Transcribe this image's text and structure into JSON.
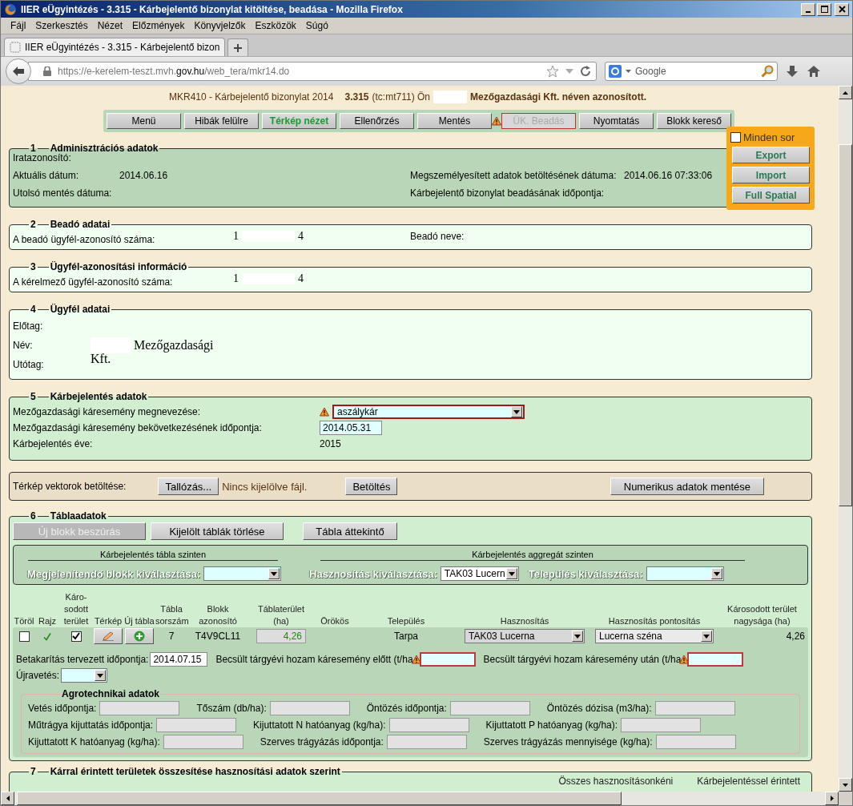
{
  "window": {
    "title": "IIER eÜgyintézés - 3.315 - Kárbejelentő bizonylat kitöltése, beadása - Mozilla Firefox"
  },
  "menu": [
    "Fájl",
    "Szerkesztés",
    "Nézet",
    "Előzmények",
    "Könyvjelzők",
    "Eszközök",
    "Súgó"
  ],
  "tabs": [
    {
      "label": "IIER eÜgyintézés - 3.315 - Kárbejelentő bizon",
      "selected": true
    }
  ],
  "address": {
    "url_start": "https://e-kerelem-teszt.mvh.",
    "url_domain": "gov.hu",
    "url_end": "/web_tera/mkr14.do"
  },
  "search": {
    "placeholder": "Google"
  },
  "header": {
    "form": "MKR410 - Kárbejelentő bizonylat 2014",
    "code": "3.315",
    "user_prefix": "(tc:mt711) Ön",
    "user_suffix": "Mezőgazdasági Kft. néven azonosított."
  },
  "toolbar": [
    {
      "label": "Menü",
      "highlighted": false,
      "disabled": false,
      "warning": false
    },
    {
      "label": "Hibák felülre",
      "highlighted": false,
      "disabled": false,
      "warning": false
    },
    {
      "label": "Térkép nézet",
      "highlighted": true,
      "disabled": false,
      "warning": false
    },
    {
      "label": "Ellenőrzés",
      "highlighted": false,
      "disabled": false,
      "warning": false
    },
    {
      "label": "Mentés",
      "highlighted": false,
      "disabled": false,
      "warning": true
    },
    {
      "label": "ÜK. Beadás",
      "highlighted": false,
      "disabled": true,
      "warning": false
    },
    {
      "label": "Nyomtatás",
      "highlighted": false,
      "disabled": false,
      "warning": false
    },
    {
      "label": "Blokk kereső",
      "highlighted": false,
      "disabled": false,
      "warning": false
    }
  ],
  "side_panel": {
    "select_all": {
      "label": "Minden sor",
      "checked": false
    },
    "buttons": [
      "Export",
      "Import",
      "Full Spatial"
    ]
  },
  "admin": {
    "number": "1",
    "title": "Adminisztrációs adatok",
    "rows": [
      {
        "left": {
          "label": "Iratazonosító:"
        }
      },
      {
        "left": {
          "label": "Aktuális dátum:",
          "value": "2014.06.16"
        },
        "right": {
          "label": "Megszemélyesített adatok betöltésének dátuma:",
          "value": "2014.06.16 07:33:06"
        }
      },
      {
        "left": {
          "label": "Utolsó mentés dátuma:"
        },
        "right": {
          "label": "Kárbejelentő bizonylat beadásának időpontja:"
        }
      }
    ]
  },
  "submitter": {
    "number": "2",
    "title": "Beadó adatai",
    "id_label": "A beadó ügyfél-azonosító száma:",
    "id_start": "1",
    "id_end": "4",
    "name_label": "Beadó neve:"
  },
  "client_id": {
    "number": "3",
    "title": "Ügyfél-azonosítási információ",
    "id_label": "A kérelmező ügyfél-azonosító száma:",
    "id_start": "1",
    "id_end": "4"
  },
  "client": {
    "number": "4",
    "title": "Ügyfél adatai",
    "prefix_label": "Előtag:",
    "name_label": "Név:",
    "name_line1": "Mezőgazdasági",
    "name_line2": "Kft.",
    "suffix_label": "Utótag:"
  },
  "damage": {
    "number": "5",
    "title": "Kárbejelentés adatok",
    "event_label": "Mezőgazdasági káresemény megnevezése:",
    "event_value": "aszálykár",
    "event_warning": true,
    "date_label": "Mezőgazdasági káresemény bekövetkezésének időpontja:",
    "date_value": "2014.05.31",
    "year_label": "Kárbejelentés éve:",
    "year_value": "2015"
  },
  "map_upload": {
    "label": "Térkép vektorok betöltése:",
    "browse": "Tallózás...",
    "file_status": "Nincs kijelölve fájl.",
    "load": "Betöltés",
    "save": "Numerikus adatok mentése"
  },
  "parcels": {
    "number": "6",
    "title": "Táblaadatok",
    "actions": [
      {
        "label": "Új blokk beszúrás",
        "disabled": true
      },
      {
        "label": "Kijelölt táblák törlése",
        "disabled": false
      },
      {
        "label": "Tábla áttekintő",
        "disabled": false
      }
    ],
    "filters": {
      "left_heading": "Kárbejelentés tábla szinten",
      "right_heading": "Kárbejelentés aggregát szinten",
      "block_label": "Megjelenítendő blokk kiválasztása:",
      "use_label": "Hasznosítás kiválasztása:",
      "use_value": "TAK03 Lucern",
      "town_label": "Település kiválasztása:"
    },
    "columns": [
      "Töröl",
      "Rajz",
      "Káro-\nsodott\nterület",
      "Térkép",
      "Új tábla",
      "Tábla\nsorszám",
      "Blokk\nazonosító",
      "Táblaterület\n(ha)",
      "Örökös",
      "Település",
      "Hasznosítás",
      "Hasznosítás pontosítás",
      "Károsodott terület\nnagysága (ha)"
    ],
    "rows": [
      {
        "delete_checked": false,
        "drawn": true,
        "damaged_checked": true,
        "number": "7",
        "block": "T4V9CL11",
        "area": "4,26",
        "town": "Tarpa",
        "use": "TAK03 Lucerna",
        "use_detail": "Lucerna széna",
        "damaged_area": "4,26",
        "harvest_label": "Betakarítás tervezett időpontja:",
        "harvest_value": "2014.07.15",
        "yield_before_label": "Becsült tárgyévi hozam káresemény előtt (t/ha",
        "yield_before_warning": true,
        "yield_after_label": "Becsült tárgyévi hozam káresemény után (t/ha",
        "yield_after_warning": true,
        "replant_label": "Újravetés:",
        "agro": {
          "title": "Agrotechnikai adatok",
          "rows": [
            [
              "Vetés időpontja:",
              "Tőszám (db/ha):",
              "Öntözés időpontja:",
              "Öntözés dózisa (m3/ha):"
            ],
            [
              "Műtrágya kijuttatás időpontja:",
              "Kijuttatott N hatóanyag (kg/ha):",
              "Kijuttatott P hatóanyag (kg/ha):"
            ],
            [
              "Kijuttatott K hatóanyag (kg/ha):",
              "Szerves trágyázás időpontja:",
              "Szerves trágyázás mennyisége (kg/ha):"
            ]
          ]
        }
      }
    ]
  },
  "summary": {
    "number": "7",
    "title": "Kárral érintett területek összesítése hasznosítási adatok szerint",
    "columns": [
      "Összes hasznosításonkéni",
      "Kárbejelentéssel érintett"
    ]
  }
}
